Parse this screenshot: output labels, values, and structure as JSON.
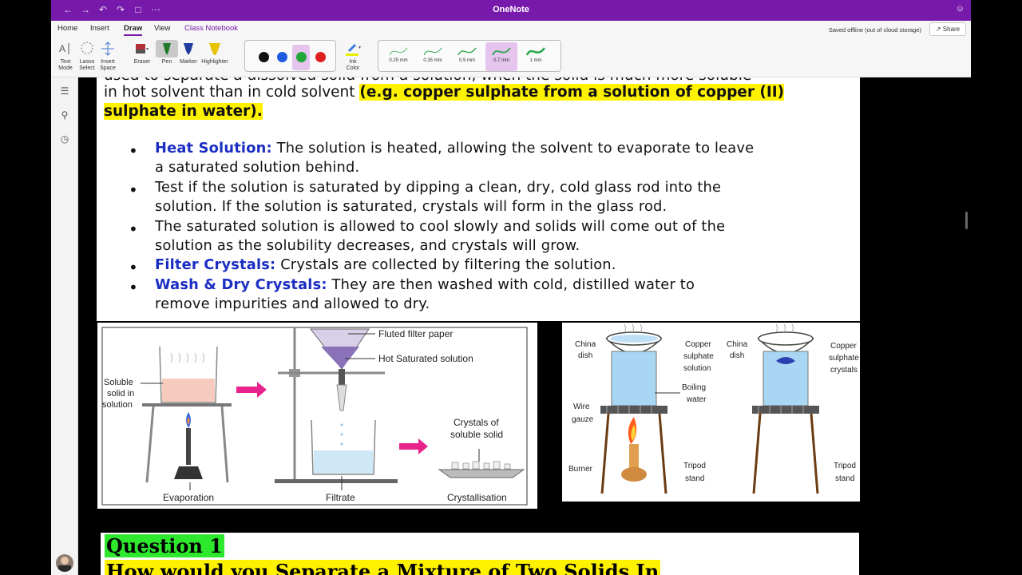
{
  "titlebar": {
    "title": "OneNote"
  },
  "tabs": [
    {
      "label": "Home"
    },
    {
      "label": "Insert"
    },
    {
      "label": "Draw"
    },
    {
      "label": "View"
    },
    {
      "label": "Class Notebook"
    }
  ],
  "status": {
    "saved": "Saved offline (out of cloud storage)",
    "share": "Share"
  },
  "ribbon": {
    "text_mode": [
      "Text",
      "Mode"
    ],
    "lasso": [
      "Lasso",
      "Select"
    ],
    "insert_space": [
      "Insert",
      "Space"
    ],
    "eraser": "Eraser",
    "pen": "Pen",
    "marker": "Marker",
    "highlighter": "Highlighter",
    "ink_color": [
      "Ink",
      "Color"
    ],
    "colors": [
      "#111111",
      "#1f5be0",
      "#22a63a",
      "#e01f1f"
    ],
    "selected_color": "#22a63a",
    "thicknesses": [
      {
        "label": "0.25 mm"
      },
      {
        "label": "0.35 mm"
      },
      {
        "label": "0.5 mm"
      },
      {
        "label": "0.7 mm"
      },
      {
        "label": "1 mm"
      }
    ],
    "selected_thickness": "0.7 mm"
  },
  "content": {
    "line1": "used to separate a dissolved solid from a solution, when the solid is much more soluble",
    "line2_plain": "in hot solvent than in cold solvent ",
    "line2_hl": "(e.g. copper sulphate from a solution of copper (II)",
    "line3_hl": "sulphate in water).",
    "bullets": [
      {
        "bold": "Heat Solution:",
        "text": " The solution is heated, allowing the solvent to evaporate to leave",
        "cont": "a saturated solution behind."
      },
      {
        "bold": "",
        "text": "Test if the solution is saturated by dipping a clean, dry, cold glass rod into the",
        "cont": "solution. If the solution is saturated, crystals will form in the glass rod."
      },
      {
        "bold": "",
        "text": "The saturated solution is allowed to cool slowly and solids will come out of the",
        "cont": "solution as the solubility decreases, and crystals will grow."
      },
      {
        "bold": "Filter Crystals:",
        "text": " Crystals are collected by filtering the solution.",
        "cont": ""
      },
      {
        "bold": "Wash & Dry Crystals:",
        "text": " They are then washed with cold, distilled water to",
        "cont": "remove impurities and allowed to dry."
      }
    ]
  },
  "figure1": {
    "soluble": [
      "Soluble",
      "solid in",
      "solution"
    ],
    "filter_paper": "Fluted filter paper",
    "hot_sat": "Hot Saturated solution",
    "crystals": [
      "Crystals of",
      "soluble solid"
    ],
    "evaporation": "Evaporation",
    "filtrate": "Filtrate",
    "crystallisation": "Crystallisation"
  },
  "figure2": {
    "china_dish": [
      "China",
      "dish"
    ],
    "copper_solution": [
      "Copper",
      "sulphate",
      "solution"
    ],
    "boiling_water": [
      "Boiling",
      "water"
    ],
    "wire_gauze": [
      "Wire",
      "gauze"
    ],
    "burner": "Burner",
    "tripod": [
      "Tripod",
      "stand"
    ],
    "china_dish_2": [
      "China",
      "dish"
    ],
    "copper_crystals": [
      "Copper",
      "sulphate",
      "crystals"
    ],
    "tripod_2": [
      "Tripod",
      "stand"
    ]
  },
  "question": {
    "q1": "Question 1",
    "q2": "How would you Separate a Mixture of  Two Solids In"
  }
}
